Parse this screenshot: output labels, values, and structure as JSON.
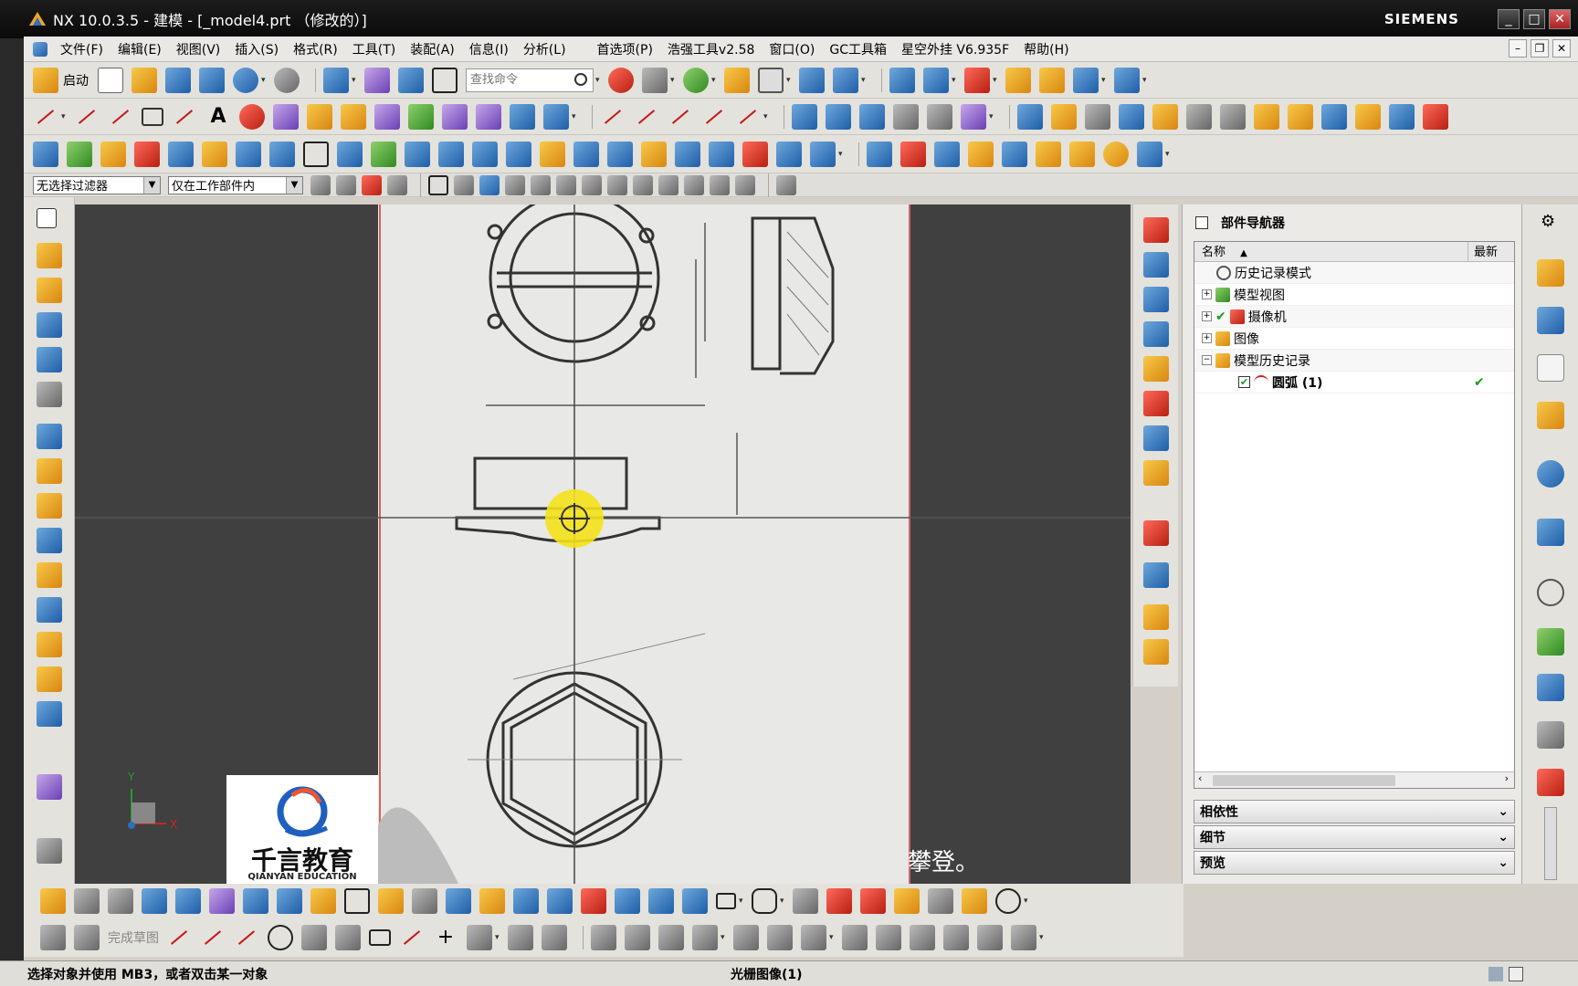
{
  "window": {
    "title": "NX 10.0.3.5 - 建模 - [_model4.prt （修改的）]",
    "brand": "SIEMENS",
    "controls": [
      "_",
      "□",
      "✕"
    ]
  },
  "menu": {
    "items": [
      "文件(F)",
      "编辑(E)",
      "视图(V)",
      "插入(S)",
      "格式(R)",
      "工具(T)",
      "装配(A)",
      "信息(I)",
      "分析(L)"
    ],
    "items_right": [
      "首选项(P)",
      "浩强工具v2.58",
      "窗口(O)",
      "GC工具箱",
      "星空外挂 V6.935F",
      "帮助(H)"
    ]
  },
  "toolbar": {
    "start_label": "启动",
    "search_placeholder": "查找命令"
  },
  "selection_bar": {
    "filter_value": "无选择过滤器",
    "scope_value": "仅在工作部件内"
  },
  "viewport": {
    "axis_labels": {
      "y": "Y",
      "x": "X"
    },
    "logo_text": "千言教育",
    "logo_subtext": "QIANYAN EDUCATION",
    "subtitle": "攀登。"
  },
  "navigator": {
    "title": "部件导航器",
    "columns": {
      "name": "名称",
      "latest": "最新"
    },
    "rows": [
      {
        "label": "历史记录模式"
      },
      {
        "label": "模型视图"
      },
      {
        "label": "摄像机"
      },
      {
        "label": "图像"
      },
      {
        "label": "模型历史记录"
      },
      {
        "label": "圆弧 (1)"
      }
    ],
    "sections": [
      "相依性",
      "细节",
      "预览"
    ]
  },
  "bottom_toolbar": {
    "finish_sketch": "完成草图"
  },
  "status": {
    "prompt": "选择对象并使用 MB3，或者双击某一对象",
    "info": "光栅图像(1)"
  }
}
